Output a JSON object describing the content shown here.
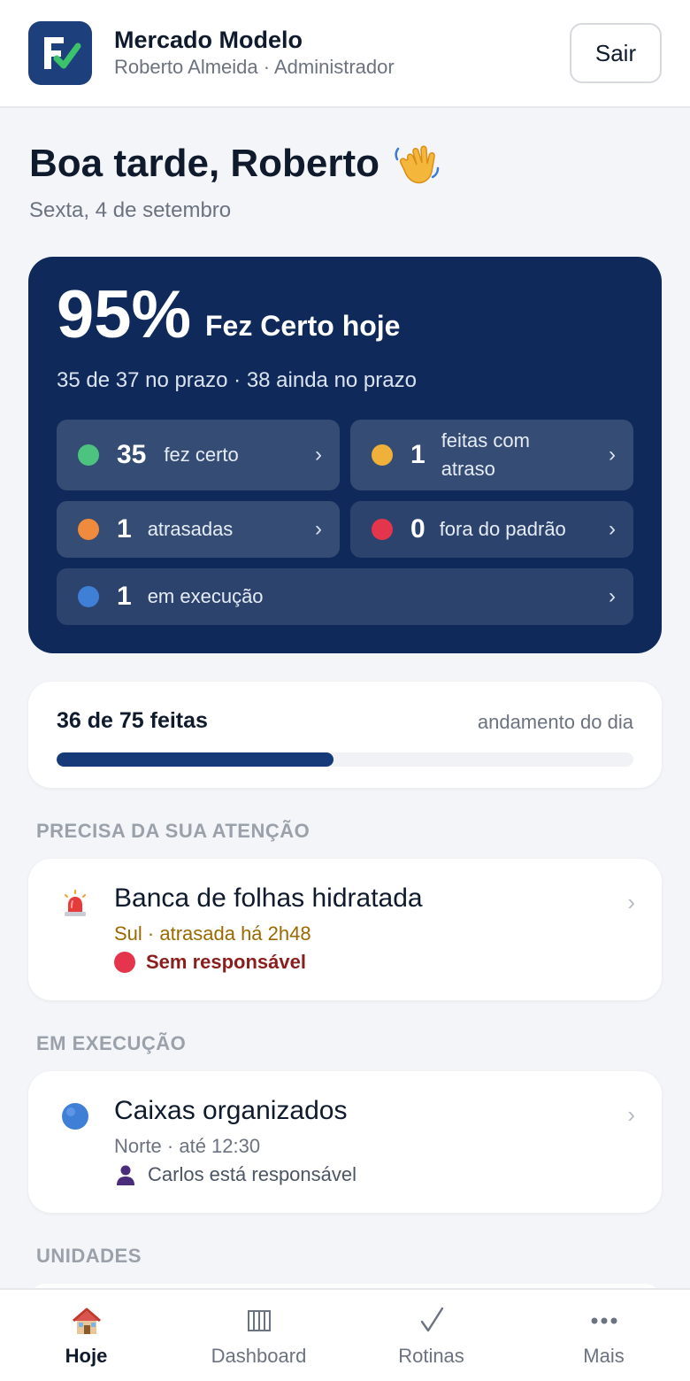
{
  "header": {
    "app_name": "Mercado Modelo",
    "user_line": "Roberto Almeida · Administrador",
    "logout_label": "Sair"
  },
  "greeting": {
    "title": "Boa tarde, Roberto",
    "date": "Sexta, 4 de setembro"
  },
  "summary": {
    "percent": "95%",
    "label": "Fez Certo hoje",
    "subline": "35 de 37 no prazo · 38 ainda no prazo",
    "stats": [
      {
        "count": "35",
        "label": "fez certo",
        "color": "#4cc37e"
      },
      {
        "count": "1",
        "label": "feitas com atraso",
        "color": "#f0b13a"
      },
      {
        "count": "1",
        "label": "atrasadas",
        "color": "#f08a3c"
      },
      {
        "count": "0",
        "label": "fora do padrão",
        "color": "#e5354d"
      },
      {
        "count": "1",
        "label": "em execução",
        "color": "#3f7fd6"
      }
    ],
    "chevron": "›"
  },
  "progress": {
    "count_label": "36 de 75 feitas",
    "caption": "andamento do dia",
    "done": 36,
    "total": 75
  },
  "sections": {
    "attention": "PRECISA DA SUA ATENÇÃO",
    "running": "EM EXECUÇÃO",
    "units": "UNIDADES"
  },
  "attention_task": {
    "title": "Banca de folhas hidratada",
    "meta": "Sul · atrasada há 2h48",
    "extra": "Sem responsável",
    "icon": "siren-icon"
  },
  "running_task": {
    "title": "Caixas organizados",
    "meta": "Norte · até 12:30",
    "extra": "Carlos está responsável",
    "icon": "blue-circle-icon"
  },
  "nav": [
    {
      "label": "Hoje",
      "icon": "house-icon"
    },
    {
      "label": "Dashboard",
      "icon": "columns-icon"
    },
    {
      "label": "Rotinas",
      "icon": "check-icon"
    },
    {
      "label": "Mais",
      "icon": "more-icon"
    }
  ],
  "colors": {
    "hero_bg": "#0f2a5a",
    "progress_fill": "#163a78",
    "late_text": "#9a6a00",
    "alert_text": "#8b1d1d"
  }
}
